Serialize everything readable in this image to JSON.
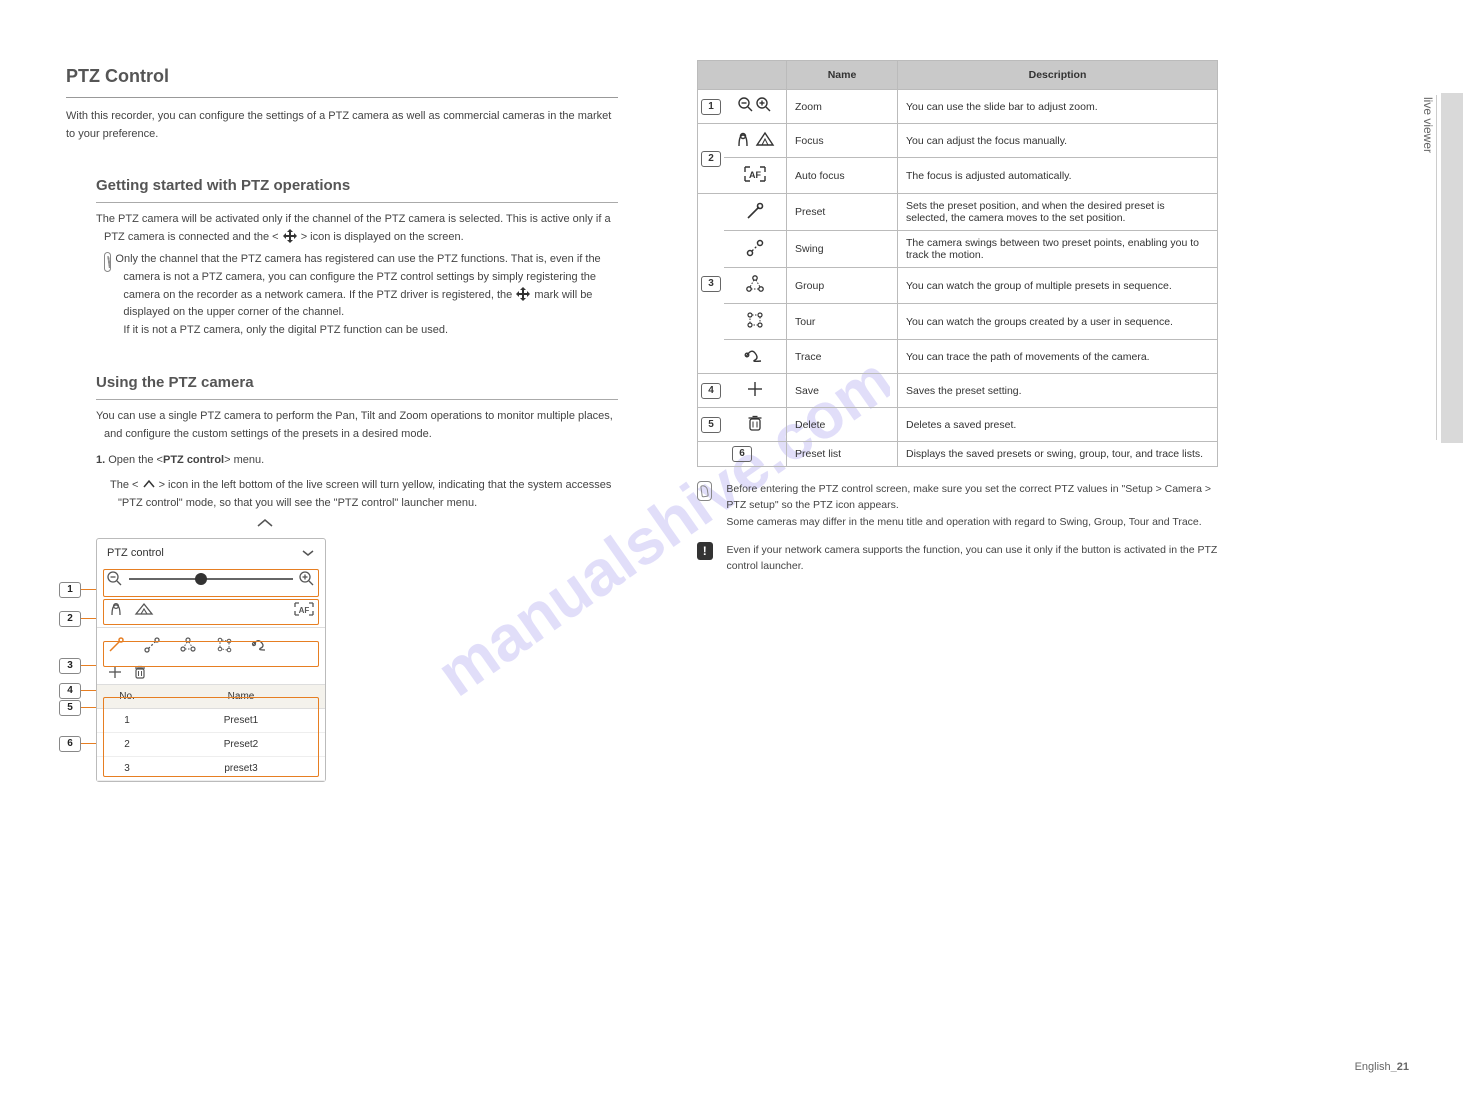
{
  "left": {
    "h1": "PTZ Control",
    "p1": "With this recorder, you can configure the settings of a PTZ camera as well as commercial cameras in the market to your preference.",
    "h2": "Getting started with PTZ operations",
    "p2a": "The PTZ camera will be activated only if the channel of the PTZ camera is selected. This is active only if a PTZ camera is connected and the < ",
    "p2b": " > icon is displayed on the screen.",
    "note1a": "Only the channel that the PTZ camera has registered can use the PTZ functions. That is, even if the camera is not a PTZ camera, you can configure the PTZ control settings by simply registering the camera on the recorder as a network camera. If the PTZ driver is registered, the ",
    "note1b": " mark will be displayed on the upper corner of the channel.",
    "note1c": "If it is not a PTZ camera, only the digital PTZ function can be used.",
    "h3": "Using the PTZ camera",
    "p3": "You can use a single PTZ camera to perform the Pan, Tilt and Zoom operations to monitor multiple places, and configure the custom settings of the presets in a desired mode.",
    "step1a": "Open the <",
    "step1b": "PTZ control",
    "step1c": "> menu.",
    "step2a": "The < ",
    "step2b": " > icon in the left bottom of the live screen will turn yellow, indicating that the system accesses \"PTZ control\" mode, so that you will see the \"PTZ control\" launcher menu."
  },
  "panel": {
    "title": "PTZ control",
    "list_hdr_no": "No.",
    "list_hdr_name": "Name",
    "rows": [
      {
        "no": "1",
        "name": "Preset1"
      },
      {
        "no": "2",
        "name": "Preset2"
      },
      {
        "no": "3",
        "name": "preset3"
      }
    ]
  },
  "table": {
    "hdr_name": "Name",
    "hdr_desc": "Description",
    "rows": [
      {
        "num": "1",
        "icon": "zoom",
        "name": "Zoom",
        "desc": "You can use the slide bar to adjust zoom."
      },
      {
        "num": "2",
        "icon": "focus",
        "name": "Focus",
        "desc": "You can adjust the focus manually."
      },
      {
        "num": "",
        "icon": "af",
        "name": "Auto focus",
        "desc": "The focus is adjusted automatically."
      },
      {
        "num": "3",
        "icon": "preset",
        "name": "Preset",
        "desc": "Sets the preset position, and when the desired preset is selected, the camera moves to the set position."
      },
      {
        "num": "",
        "icon": "swing",
        "name": "Swing",
        "desc": "The camera swings between two preset points, enabling you to track the motion."
      },
      {
        "num": "",
        "icon": "group",
        "name": "Group",
        "desc": "You can watch the group of multiple presets in sequence."
      },
      {
        "num": "",
        "icon": "tour",
        "name": "Tour",
        "desc": "You can watch the groups created by a user in sequence."
      },
      {
        "num": "",
        "icon": "trace",
        "name": "Trace",
        "desc": "You can trace the path of movements of the camera."
      },
      {
        "num": "4",
        "icon": "save",
        "name": "Save",
        "desc": "Saves the preset setting."
      },
      {
        "num": "5",
        "icon": "delete",
        "name": "Delete",
        "desc": "Deletes a saved preset."
      },
      {
        "num": "6",
        "icon": "",
        "name": "Preset list",
        "desc": "Displays the saved presets or swing, group, tour, and trace lists."
      }
    ]
  },
  "rightnotes": {
    "n1": "Before entering the PTZ control screen, make sure you set the correct PTZ values in \"Setup > Camera > PTZ setup\" so the PTZ icon appears.",
    "n2": "Some cameras may differ in the menu title and operation with regard to Swing, Group, Tour and Trace.",
    "n3": "Even if your network camera supports the function, you can use it only if the button is activated in the PTZ control launcher."
  },
  "side": {
    "label": "live viewer"
  },
  "footer": {
    "p1": "English",
    "p2": "_21"
  }
}
